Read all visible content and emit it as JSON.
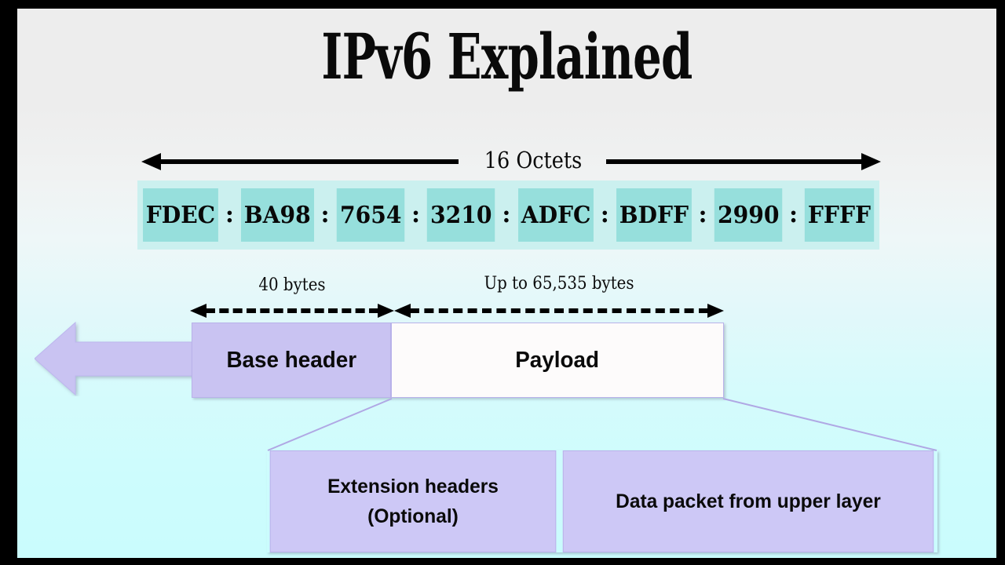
{
  "slide": {
    "title": "IPv6 Explained",
    "background_top": "#ededed",
    "background_bottom": "#cafcfd",
    "frame_color": "#000000"
  },
  "address_diagram": {
    "measure_label": "16 Octets",
    "strip_color": "#cbf0ef",
    "cell_color": "#96dfdc",
    "separator": ":",
    "groups": [
      "FDEC",
      "BA98",
      "7654",
      "3210",
      "ADFC",
      "BDFF",
      "2990",
      "FFFF"
    ]
  },
  "packet_diagram": {
    "header_size_label": "40 bytes",
    "payload_size_label": "Up to 65,535 bytes",
    "base_header_label": "Base header",
    "payload_label": "Payload",
    "base_header_color": "#c9c3f2",
    "payload_color": "#fdfbfb",
    "flow_arrow_color": "#c9c3f2"
  },
  "payload_detail": {
    "extension_headers_label": "Extension headers\n(Optional)",
    "data_packet_label": "Data packet from upper layer",
    "box_color": "#cdc8f6"
  }
}
